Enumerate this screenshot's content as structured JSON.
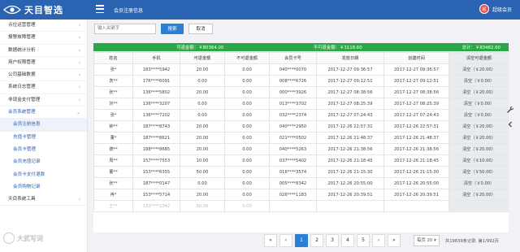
{
  "app": {
    "logo_text": "天目智选",
    "breadcrumb": "会员注册信息",
    "user_name": "超级会员",
    "avatar_label": "超"
  },
  "sidebar": {
    "items": [
      {
        "label": "点位运营管理",
        "chevron": "‹"
      },
      {
        "label": "报警故障管理",
        "chevron": "‹"
      },
      {
        "label": "数据统计分析",
        "chevron": "‹"
      },
      {
        "label": "用户权限管理",
        "chevron": "‹"
      },
      {
        "label": "公司基础数据",
        "chevron": "‹"
      },
      {
        "label": "系统日志管理",
        "chevron": "‹"
      },
      {
        "label": "非现金支付管理",
        "chevron": "‹"
      },
      {
        "label": "会员系统管理",
        "chevron": "⌄"
      }
    ],
    "subitems": [
      "会员注册信息",
      "充值卡管理",
      "会员卡管理",
      "会员充值记录",
      "会员卡支付退款",
      "会员购物记录"
    ],
    "last_item": {
      "label": "天目系统工具",
      "chevron": "‹"
    }
  },
  "toolbar": {
    "search_placeholder": "输入关键字",
    "search_label": "搜索",
    "cancel_label": "取消"
  },
  "summary": {
    "refundable": "可退金额：￥80364.00",
    "non_refundable": "不可退金额：￥3118.60",
    "total": "总计：￥83482.60"
  },
  "table": {
    "headers": [
      "姓名",
      "手机",
      "可退金额",
      "不可退金额",
      "会员卡号",
      "发放日期",
      "创建时间",
      "清空可退金额"
    ],
    "rows": [
      [
        "张*",
        "183****5942",
        "20.00",
        "0.00",
        "040****0070",
        "2017-12-27 09:36:57",
        "2017-12-27 09:36:57",
        "清空（￥20.00）"
      ],
      [
        "袁**",
        "176****6091",
        "0.00",
        "0.00",
        "008****6726",
        "2017-12-27 09:12:51",
        "2017-12-27 09:12:51",
        "清空（￥0.00）"
      ],
      [
        "张**",
        "136****5802",
        "20.00",
        "0.00",
        "000****3926",
        "2017-12-27 08:38:56",
        "2017-12-27 08:38:56",
        "清空（￥20.00）"
      ],
      [
        "刘**",
        "136****3207",
        "0.00",
        "0.00",
        "013****3702",
        "2017-12-27 08:25:39",
        "2017-12-27 08:25:39",
        "清空（￥0.00）"
      ],
      [
        "张*",
        "136****7202",
        "0.00",
        "0.00",
        "032****2374",
        "2017-12-27 07:24:43",
        "2017-12-27 07:24:43",
        "清空（￥0.00）"
      ],
      [
        "钟**",
        "187****8743",
        "20.00",
        "0.00",
        "040****2950",
        "2017-12-26 22:57:31",
        "2017-12-26 22:57:31",
        "清空（￥20.00）"
      ],
      [
        "董*",
        "187****8621",
        "20.00",
        "0.00",
        "021****0502",
        "2017-12-26 21:48:37",
        "2017-12-26 21:48:37",
        "清空（￥20.00）"
      ],
      [
        "德**",
        "188****8685",
        "20.00",
        "0.00",
        "040****5263",
        "2017-12-26 21:38:56",
        "2017-12-26 21:38:56",
        "清空（￥20.00）"
      ],
      [
        "周**",
        "157****7553",
        "10.00",
        "0.00",
        "037****5402",
        "2017-12-26 21:18:45",
        "2017-12-26 21:18:45",
        "清空（￥10.00）"
      ],
      [
        "董**",
        "153****6355",
        "50.00",
        "0.00",
        "016****3574",
        "2017-12-26 21:15:30",
        "2017-12-26 21:15:30",
        "清空（￥50.00）"
      ],
      [
        "张**",
        "187****0147",
        "0.00",
        "0.00",
        "005****8342",
        "2017-12-26 20:55:00",
        "2017-12-26 20:55:00",
        "清空（￥0.00）"
      ],
      [
        "冉*",
        "153****5714",
        "20.00",
        "0.00",
        "026****1183",
        "2017-12-26 20:39:51",
        "2017-12-26 20:39:51",
        "清空（￥20.00）"
      ],
      [
        "王**",
        "131****2342",
        "50.00",
        "0.00",
        "",
        "",
        "",
        ""
      ]
    ]
  },
  "pagination": {
    "first": "«",
    "prev": "‹",
    "pages": [
      "1",
      "2",
      "3",
      "4",
      "5"
    ],
    "next": "›",
    "last": "»",
    "per_page": "每页 20 ▾",
    "total_text": "共19839条记录, 第1/992页"
  },
  "tools": {
    "wrench": "wrench-icon",
    "chevron": "chevron-left-icon"
  },
  "watermark": {
    "text": "大武写词"
  }
}
